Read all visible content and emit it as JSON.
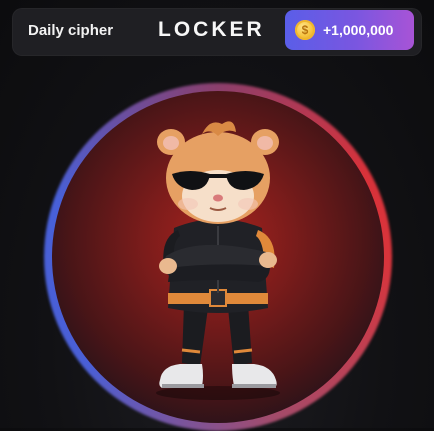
{
  "header": {
    "daily_cipher_label": "Daily cipher",
    "title": "LOCKER",
    "reward": {
      "amount": "+1,000,000",
      "icon": "coin-icon",
      "coin_symbol": "$"
    }
  },
  "main": {
    "character_icon": "hamster-character-icon"
  },
  "colors": {
    "reward_gradient_start": "#5a5ee8",
    "reward_gradient_end": "#a854d6",
    "halo_red": "#d9343b",
    "halo_blue": "#4a5fd6"
  }
}
